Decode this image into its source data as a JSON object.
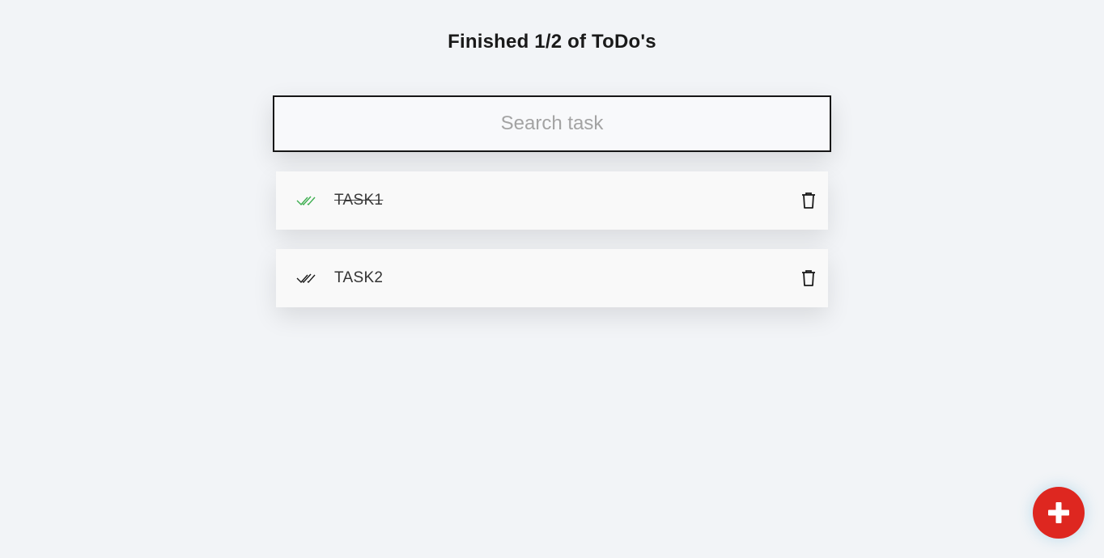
{
  "header": {
    "title": "Finished 1/2 of ToDo's"
  },
  "search": {
    "placeholder": "Search task",
    "value": ""
  },
  "tasks": [
    {
      "label": "TASK1",
      "done": true
    },
    {
      "label": "TASK2",
      "done": false
    }
  ],
  "colors": {
    "background": "#f2f4f7",
    "done_check": "#3dae4f",
    "pending_check": "#1a1a1a",
    "fab": "#de2720"
  },
  "icons": {
    "check": "double-check-icon",
    "delete": "trash-icon",
    "add": "plus-icon"
  }
}
